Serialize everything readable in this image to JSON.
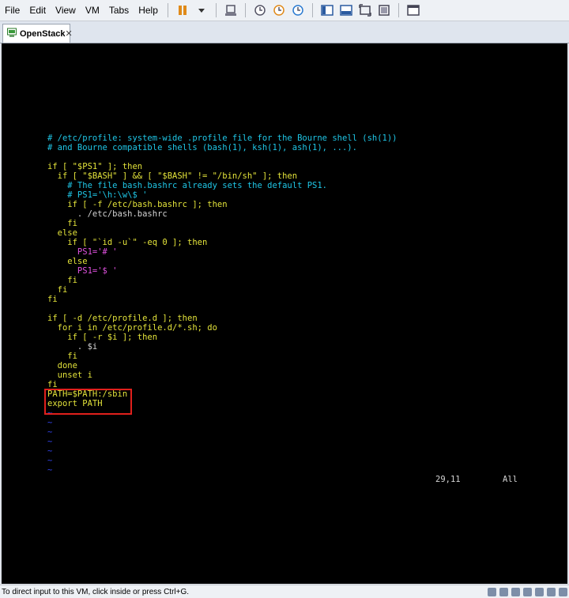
{
  "menubar": {
    "items": [
      {
        "label": "File"
      },
      {
        "label": "Edit"
      },
      {
        "label": "View"
      },
      {
        "label": "VM"
      },
      {
        "label": "Tabs"
      },
      {
        "label": "Help"
      }
    ]
  },
  "tab": {
    "label": "OpenStack",
    "close": "✕"
  },
  "terminal": {
    "lines": [
      "# /etc/profile: system-wide .profile file for the Bourne shell (sh(1))",
      "# and Bourne compatible shells (bash(1), ksh(1), ash(1), ...).",
      "",
      "if [ \"$PS1\" ]; then",
      "  if [ \"$BASH\" ] && [ \"$BASH\" != \"/bin/sh\" ]; then",
      "    # The file bash.bashrc already sets the default PS1.",
      "    # PS1='\\h:\\w\\$ '",
      "    if [ -f /etc/bash.bashrc ]; then",
      "      . /etc/bash.bashrc",
      "    fi",
      "  else",
      "    if [ \"`id -u`\" -eq 0 ]; then",
      "      PS1='# '",
      "    else",
      "      PS1='$ '",
      "    fi",
      "  fi",
      "fi",
      "",
      "if [ -d /etc/profile.d ]; then",
      "  for i in /etc/profile.d/*.sh; do",
      "    if [ -r $i ]; then",
      "      . $i",
      "    fi",
      "  done",
      "  unset i",
      "fi",
      "PATH=$PATH:/sbin",
      "export PATH",
      "~",
      "~",
      "~",
      "~",
      "~",
      "~",
      "~"
    ],
    "cursor_position": "29,11",
    "scroll_position": "All"
  },
  "statusbar": {
    "message": "To direct input to this VM, click inside or press Ctrl+G."
  }
}
